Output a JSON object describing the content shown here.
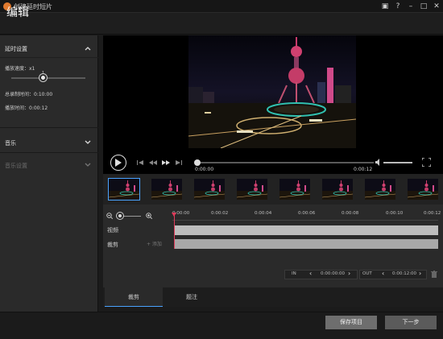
{
  "window": {
    "title": "创建延时短片",
    "controls": [
      "toolbox-icon",
      "help-icon",
      "minimize-icon",
      "maximize-icon",
      "close-icon"
    ]
  },
  "header": {
    "title": "编辑"
  },
  "sidebar": {
    "timelapse": {
      "title": "延时设置",
      "speed_label": "播放速度：x1",
      "speed_tick": "1",
      "record_time": "总录制时间：0:10:00",
      "play_time": "播放时间：0:00:12"
    },
    "music": {
      "title": "音乐"
    },
    "music_settings": {
      "title": "音乐设置"
    }
  },
  "player": {
    "current_time": "0:00:00",
    "end_time": "0:00:12"
  },
  "timeline": {
    "ticks": [
      "0:00:00",
      "0:00:02",
      "0:00:04",
      "0:00:06",
      "0:00:08",
      "0:00:10",
      "0:00:12"
    ],
    "tracks": {
      "video": "视频",
      "trim": "裁剪",
      "add": "+ 添加"
    }
  },
  "inout": {
    "in_label": "IN",
    "in_time": "0:00:00:00",
    "out_label": "OUT",
    "out_time": "0:00:12:00"
  },
  "tabs": {
    "trim": "裁剪",
    "annotate": "题注"
  },
  "footer": {
    "save": "保存项目",
    "next": "下一步"
  },
  "colors": {
    "accent": "#4aa3ff",
    "playhead": "#e03a5a",
    "sky": "#0a0a16"
  }
}
